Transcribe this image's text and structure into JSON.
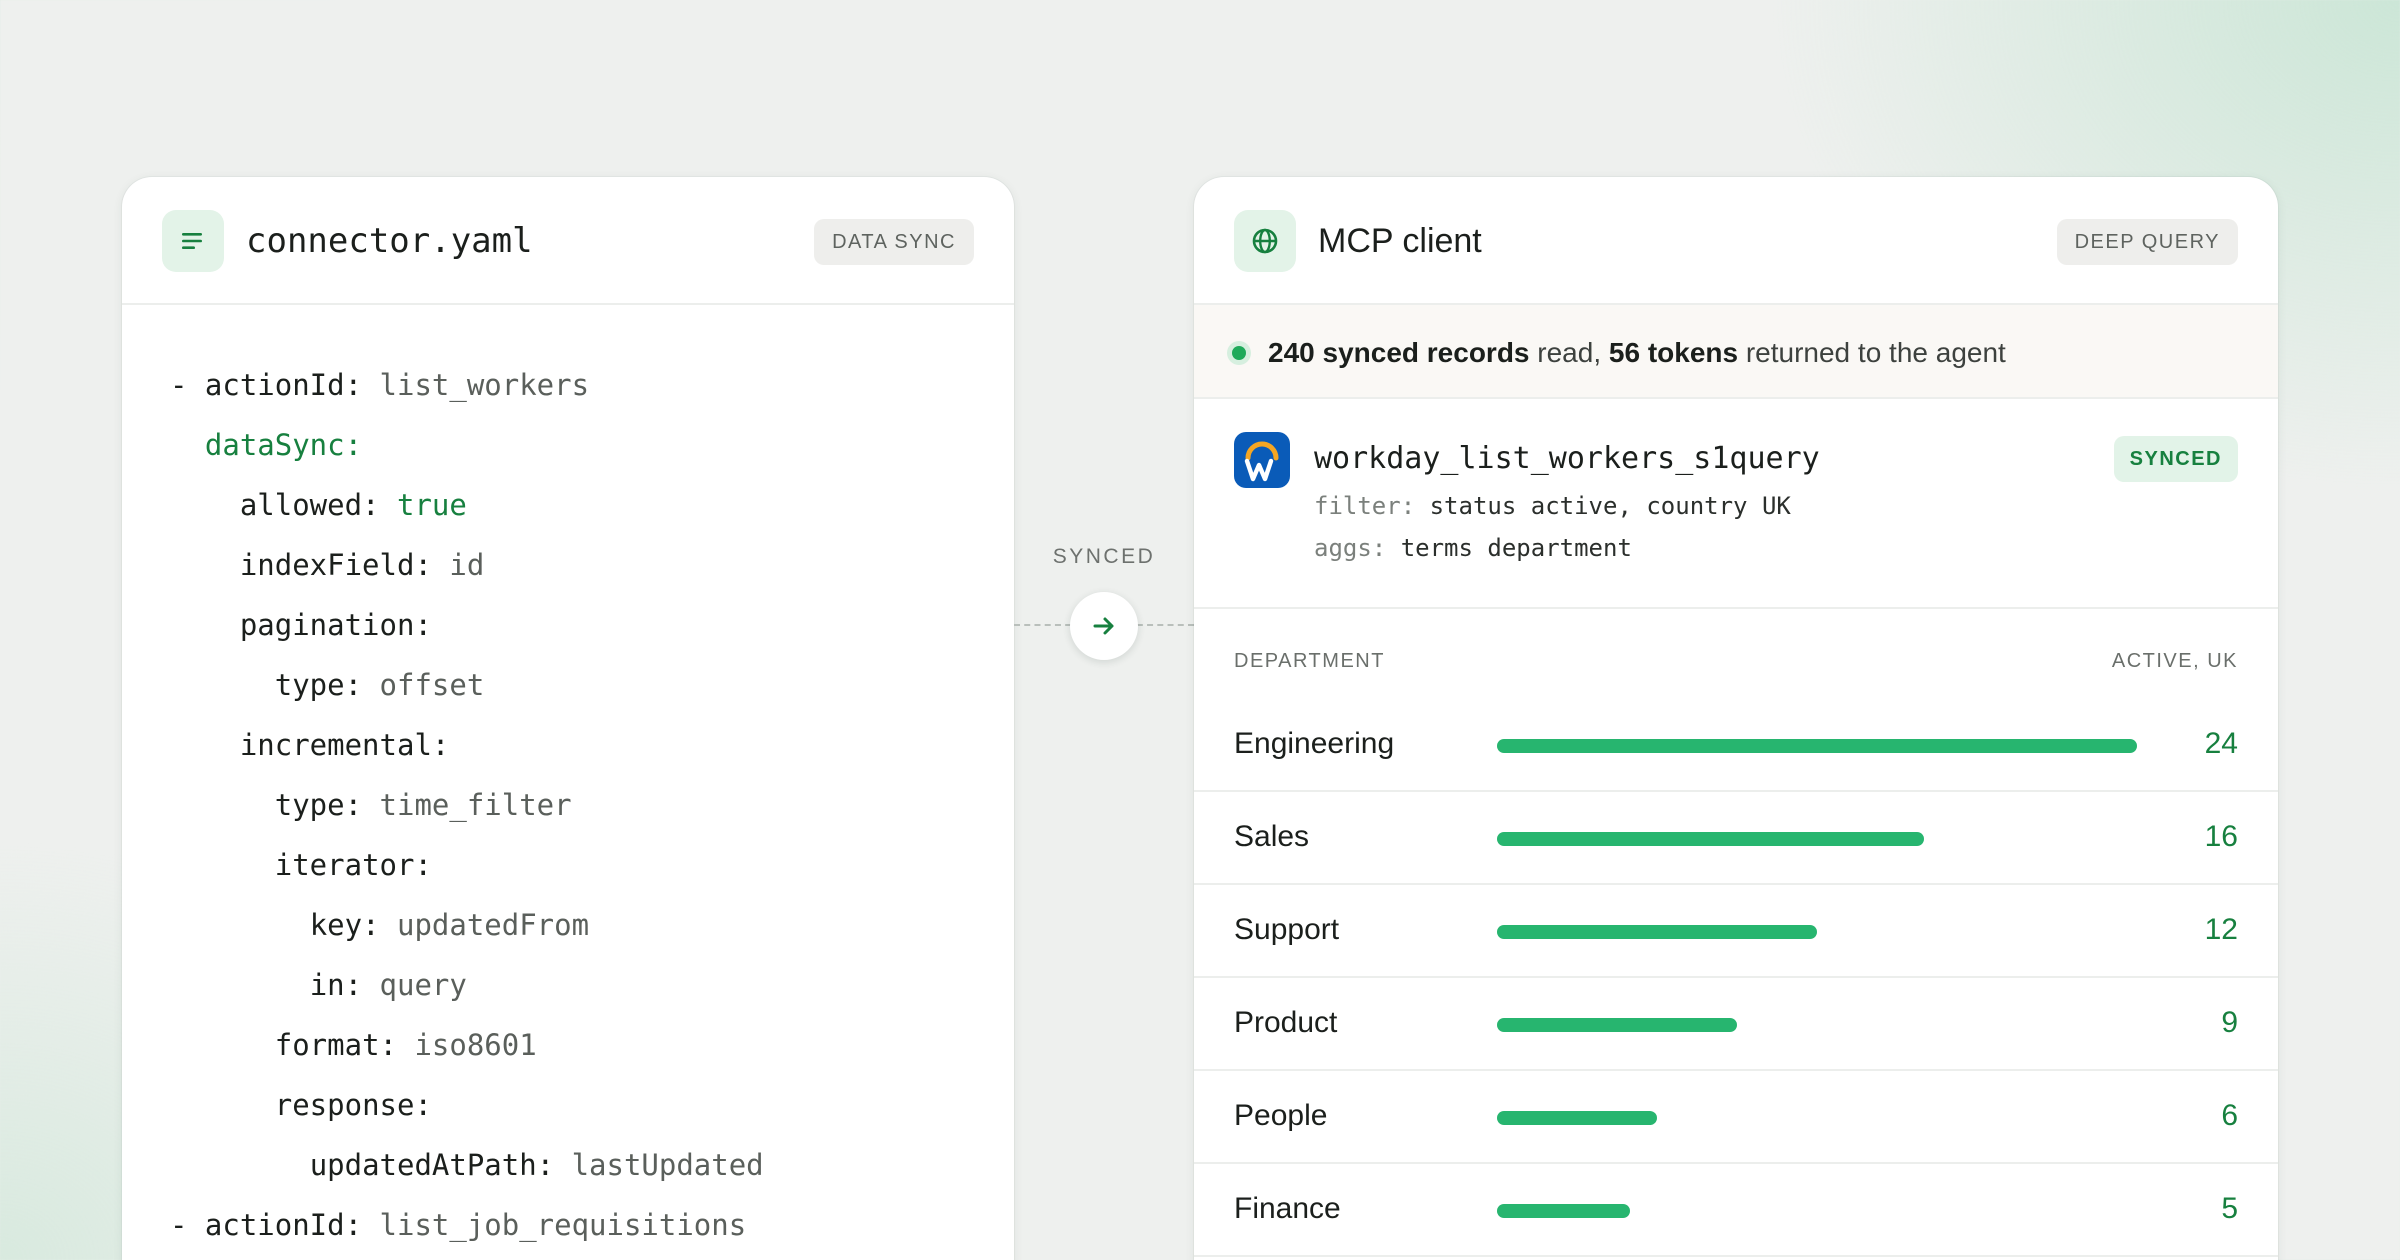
{
  "left_card": {
    "title": "connector.yaml",
    "badge": "DATA SYNC",
    "icon": "list-lines-icon",
    "lines": [
      {
        "indent": "",
        "key": "- actionId:",
        "value": " list_workers",
        "key_style": "key",
        "value_style": "val"
      },
      {
        "indent": "  ",
        "key": "dataSync:",
        "value": "",
        "key_style": "green",
        "value_style": "val"
      },
      {
        "indent": "    ",
        "key": "allowed:",
        "value": " true",
        "key_style": "key",
        "value_style": "green"
      },
      {
        "indent": "    ",
        "key": "indexField:",
        "value": " id",
        "key_style": "key",
        "value_style": "val"
      },
      {
        "indent": "    ",
        "key": "pagination:",
        "value": "",
        "key_style": "key",
        "value_style": "val"
      },
      {
        "indent": "      ",
        "key": "type:",
        "value": " offset",
        "key_style": "key",
        "value_style": "val"
      },
      {
        "indent": "    ",
        "key": "incremental:",
        "value": "",
        "key_style": "key",
        "value_style": "val"
      },
      {
        "indent": "      ",
        "key": "type:",
        "value": " time_filter",
        "key_style": "key",
        "value_style": "val"
      },
      {
        "indent": "      ",
        "key": "iterator:",
        "value": "",
        "key_style": "key",
        "value_style": "val"
      },
      {
        "indent": "        ",
        "key": "key:",
        "value": " updatedFrom",
        "key_style": "key",
        "value_style": "val"
      },
      {
        "indent": "        ",
        "key": "in:",
        "value": " query",
        "key_style": "key",
        "value_style": "val"
      },
      {
        "indent": "      ",
        "key": "format:",
        "value": " iso8601",
        "key_style": "key",
        "value_style": "val"
      },
      {
        "indent": "      ",
        "key": "response:",
        "value": "",
        "key_style": "key",
        "value_style": "val"
      },
      {
        "indent": "        ",
        "key": "updatedAtPath:",
        "value": " lastUpdated",
        "key_style": "key",
        "value_style": "val"
      },
      {
        "indent": "",
        "key": "- actionId:",
        "value": " list_job_requisitions",
        "key_style": "key",
        "value_style": "val"
      }
    ]
  },
  "connector": {
    "label": "SYNCED",
    "icon": "arrow-right-icon"
  },
  "right_card": {
    "title": "MCP client",
    "badge": "DEEP QUERY",
    "icon": "globe-icon",
    "status": {
      "records": "240 synced records",
      "read_text": " read, ",
      "tokens": "56 tokens",
      "tail_text": " returned to the agent"
    },
    "query": {
      "name": "workday_list_workers_s1query",
      "badge": "SYNCED",
      "logo_icon": "workday-logo-icon",
      "filter_key": "filter:",
      "filter_value": " status active, country UK",
      "aggs_key": "aggs:",
      "aggs_value": " terms department"
    },
    "table": {
      "col_left": "DEPARTMENT",
      "col_right": "ACTIVE, UK",
      "max": 24,
      "rows": [
        {
          "department": "Engineering",
          "count": 24
        },
        {
          "department": "Sales",
          "count": 16
        },
        {
          "department": "Support",
          "count": 12
        },
        {
          "department": "Product",
          "count": 9
        },
        {
          "department": "People",
          "count": 6
        },
        {
          "department": "Finance",
          "count": 5
        }
      ]
    }
  },
  "colors": {
    "accent_green": "#17803f",
    "bar_green": "#27b56f",
    "workday_blue": "#0a5bb8",
    "workday_orange": "#f5a623"
  }
}
